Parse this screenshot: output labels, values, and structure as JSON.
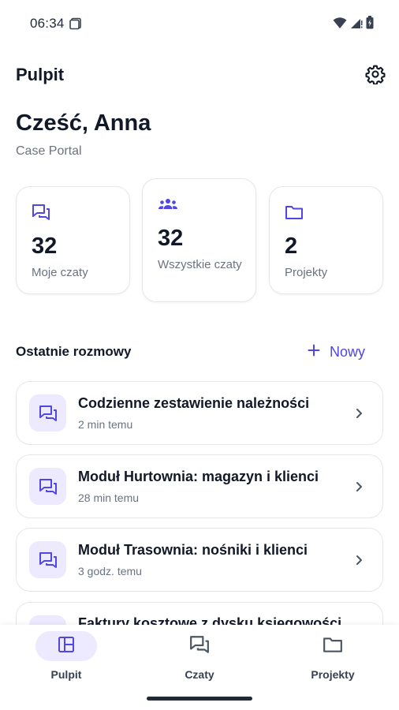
{
  "status_bar": {
    "time": "06:34"
  },
  "header": {
    "title": "Pulpit"
  },
  "greeting": "Cześć, Anna",
  "subtitle": "Case Portal",
  "stats": [
    {
      "icon": "chat-icon",
      "value": "32",
      "label": "Moje czaty"
    },
    {
      "icon": "users-icon",
      "value": "32",
      "label": "Wszystkie czaty"
    },
    {
      "icon": "folder-icon",
      "value": "2",
      "label": "Projekty"
    }
  ],
  "recent": {
    "title": "Ostatnie rozmowy",
    "new_label": "Nowy",
    "items": [
      {
        "title": "Codzienne zestawienie należności",
        "time": "2 min temu"
      },
      {
        "title": "Moduł Hurtownia: magazyn i klienci",
        "time": "28 min temu"
      },
      {
        "title": "Moduł Trasownia: nośniki i klienci",
        "time": "3 godz. temu"
      },
      {
        "title": "Faktury kosztowe z dysku księgowości",
        "time": ""
      }
    ]
  },
  "nav": [
    {
      "label": "Pulpit",
      "icon": "dashboard-icon",
      "active": true
    },
    {
      "label": "Czaty",
      "icon": "chat-icon",
      "active": false
    },
    {
      "label": "Projekty",
      "icon": "folder-icon",
      "active": false
    }
  ],
  "colors": {
    "accent": "#4f46e5",
    "accent_soft": "#ede9fe",
    "text": "#111827",
    "muted": "#6b7280"
  }
}
